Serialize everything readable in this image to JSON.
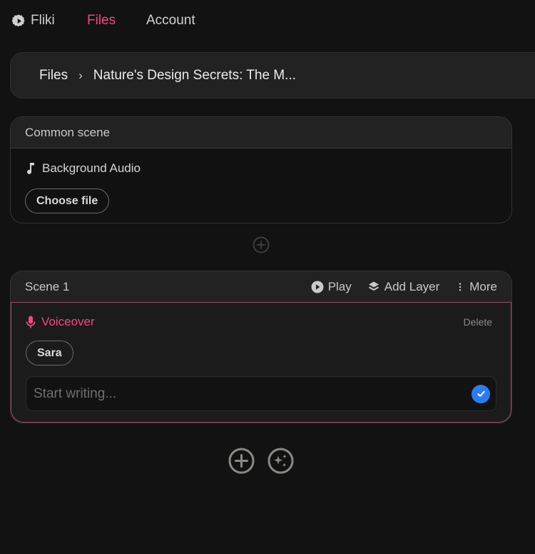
{
  "nav": {
    "brand": "Fliki",
    "links": [
      {
        "label": "Files",
        "active": true
      },
      {
        "label": "Account",
        "active": false
      }
    ]
  },
  "breadcrumb": {
    "root": "Files",
    "separator": "›",
    "current": "Nature's Design Secrets: The M..."
  },
  "common_scene": {
    "title": "Common scene",
    "audio_label": "Background Audio",
    "choose_file_label": "Choose file"
  },
  "scene": {
    "title": "Scene 1",
    "actions": {
      "play": "Play",
      "add_layer": "Add Layer",
      "more": "More"
    },
    "layer": {
      "label": "Voiceover",
      "delete_label": "Delete",
      "voice": "Sara",
      "text_value": "",
      "placeholder": "Start writing..."
    }
  },
  "colors": {
    "accent": "#f0497e",
    "confirm": "#2a7cf0",
    "background": "#121212"
  },
  "icons": {
    "brand": "gear-play-icon",
    "audio": "music-note-icon",
    "divider_add": "plus-circle-icon",
    "play": "play-circle-icon",
    "add_layer": "layers-icon",
    "more": "vertical-dots-icon",
    "voiceover": "microphone-icon",
    "confirm": "check-circle-icon",
    "add_scene": "plus-circle-icon",
    "ai_magic": "sparkles-circle-icon"
  }
}
